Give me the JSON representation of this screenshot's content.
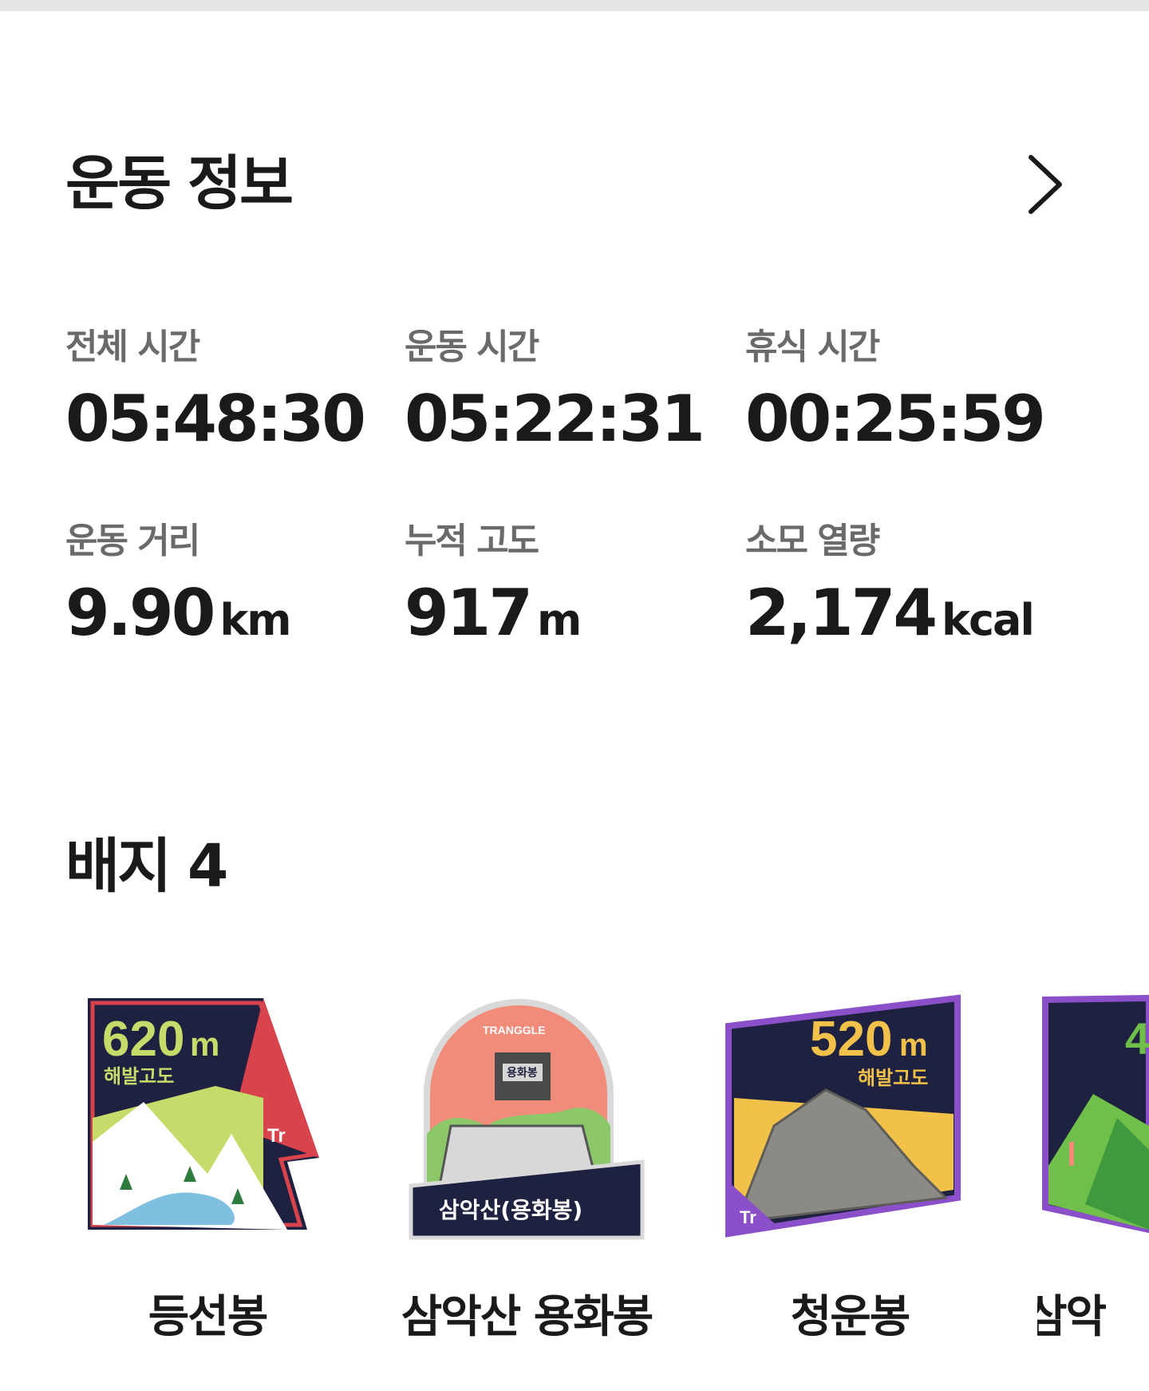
{
  "exercise_info": {
    "title": "운동 정보",
    "chevron_icon": "chevron-right-icon"
  },
  "stats": [
    {
      "label": "전체 시간",
      "value": "05:48:30",
      "unit": ""
    },
    {
      "label": "운동 시간",
      "value": "05:22:31",
      "unit": ""
    },
    {
      "label": "휴식 시간",
      "value": "00:25:59",
      "unit": ""
    },
    {
      "label": "운동 거리",
      "value": "9.90",
      "unit": "km"
    },
    {
      "label": "누적 고도",
      "value": "917",
      "unit": "m"
    },
    {
      "label": "소모 열량",
      "value": "2,174",
      "unit": "kcal"
    }
  ],
  "badges_section": {
    "title": "배지 4"
  },
  "badges": [
    {
      "name": "등선봉",
      "altitude": "620",
      "altitude_unit": "m",
      "altitude_label": "해발고도",
      "logo": "Tr"
    },
    {
      "name": "삼악산 용화봉",
      "banner": "삼악산(용화봉)",
      "sign": "용화봉",
      "arc_text": "TRANGGLE"
    },
    {
      "name": "청운봉",
      "altitude": "520",
      "altitude_unit": "m",
      "altitude_label": "해발고도",
      "logo": "Tr"
    },
    {
      "name": "삼악",
      "altitude": "4"
    }
  ],
  "colors": {
    "badge_navy": "#1e2140",
    "badge_red": "#d9434b",
    "badge_green": "#c5dc6a",
    "badge_purple": "#8a4fc9",
    "badge_yellow": "#f2c14a",
    "badge_salmon": "#f28c7a"
  }
}
